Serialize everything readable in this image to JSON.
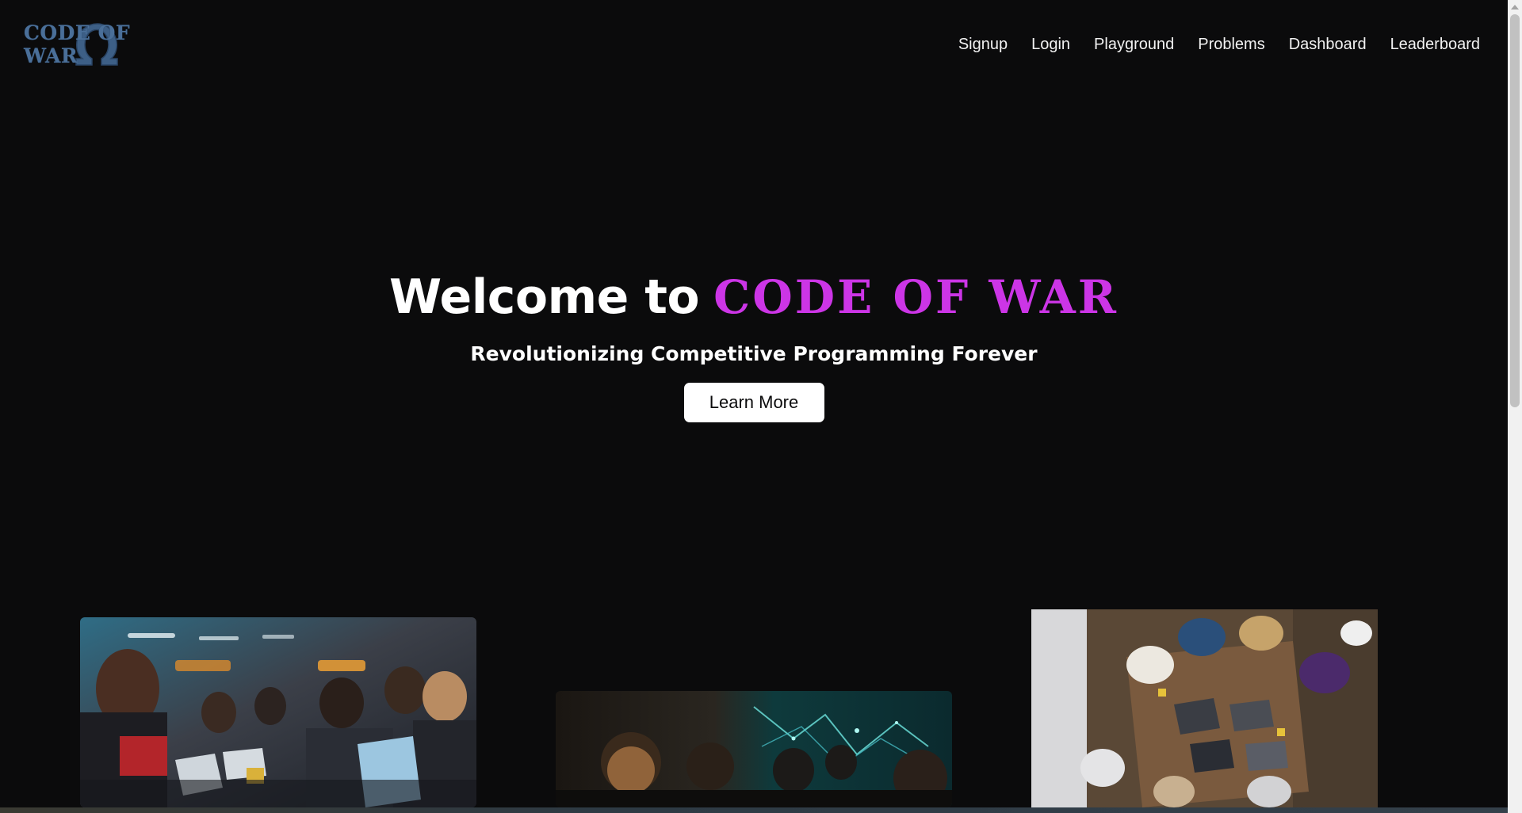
{
  "header": {
    "logo_text": "CODE OF WAR",
    "nav": [
      {
        "label": "Signup"
      },
      {
        "label": "Login"
      },
      {
        "label": "Playground"
      },
      {
        "label": "Problems"
      },
      {
        "label": "Dashboard"
      },
      {
        "label": "Leaderboard"
      }
    ]
  },
  "hero": {
    "title_prefix": "Welcome to",
    "title_brand": "CODE OF WAR",
    "subtitle": "Revolutionizing Competitive Programming Forever",
    "cta_label": "Learn More"
  },
  "colors": {
    "background": "#0b0b0c",
    "brand_accent": "#cc35e6",
    "logo_color": "#4a6f99"
  }
}
